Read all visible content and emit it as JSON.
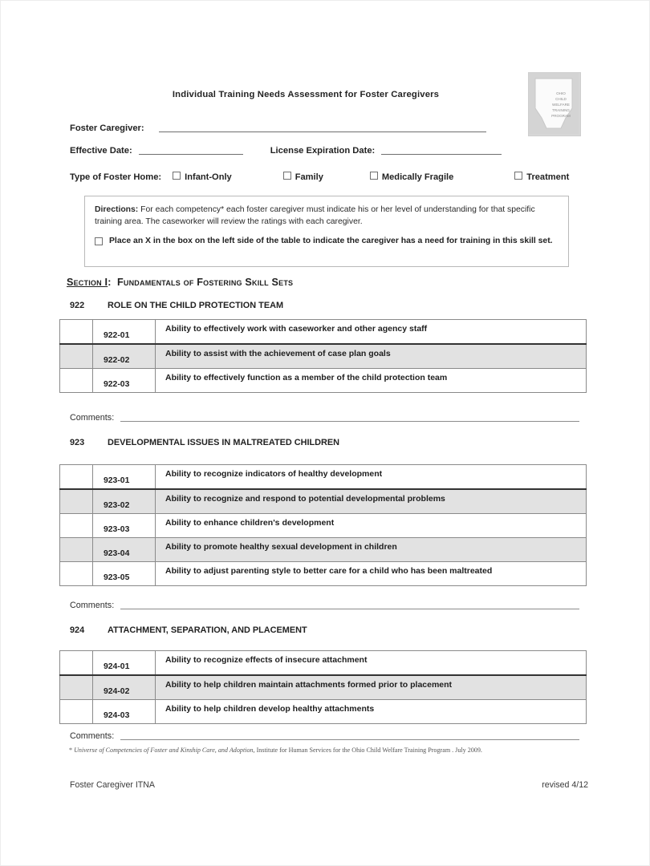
{
  "document": {
    "title": "Individual Training Needs Assessment for Foster Caregivers",
    "logo": {
      "name": "ohio-child-welfare-training-program-logo",
      "lines": [
        "OHIO",
        "CHILD",
        "WELFARE",
        "TRAINING",
        "PROGRAM"
      ]
    }
  },
  "fields": {
    "foster_caregiver_label": "Foster Caregiver:",
    "foster_caregiver_value": "",
    "effective_date_label": "Effective Date:",
    "effective_date_value": "",
    "license_expiration_label": "License Expiration Date:",
    "license_expiration_value": "",
    "type_of_home_label": "Type of Foster Home:",
    "type_options": [
      {
        "label": "Infant-Only",
        "checked": false
      },
      {
        "label": "Family",
        "checked": false
      },
      {
        "label": "Medically Fragile",
        "checked": false
      },
      {
        "label": "Treatment",
        "checked": false
      }
    ]
  },
  "directions": {
    "heading": "Directions:",
    "body": "For each competency* each foster caregiver must indicate his or her level of understanding for that specific training area.  The caseworker will review the ratings with each caregiver.",
    "note": "Place an X in the box on the left side of the table to indicate the caregiver has a need for training in this skill set.",
    "note_checked": false
  },
  "section": {
    "id": "Section I",
    "separator": ":",
    "title": "Fundamentals of Fostering Skill Sets"
  },
  "groups": [
    {
      "code": "922",
      "title": "ROLE ON THE CHILD PROTECTION TEAM",
      "rows": [
        {
          "code": "922-01",
          "desc": "Ability to effectively work with caseworker and other agency staff",
          "shaded": false,
          "checked": false
        },
        {
          "code": "922-02",
          "desc": "Ability to assist with the achievement of case plan goals",
          "shaded": true,
          "checked": false
        },
        {
          "code": "922-03",
          "desc": "Ability to effectively function as a member of the child protection team",
          "shaded": false,
          "checked": false
        }
      ],
      "comments_label": "Comments:",
      "comments_value": ""
    },
    {
      "code": "923",
      "title": "DEVELOPMENTAL ISSUES IN MALTREATED CHILDREN",
      "rows": [
        {
          "code": "923-01",
          "desc": "Ability to recognize indicators of healthy development",
          "shaded": false,
          "checked": false
        },
        {
          "code": "923-02",
          "desc": "Ability to recognize and respond to potential developmental problems",
          "shaded": true,
          "checked": false
        },
        {
          "code": "923-03",
          "desc": "Ability to enhance children's development",
          "shaded": false,
          "checked": false
        },
        {
          "code": "923-04",
          "desc": "Ability to promote healthy sexual development in children",
          "shaded": true,
          "checked": false
        },
        {
          "code": "923-05",
          "desc": "Ability to adjust parenting style to better care for a child who has been maltreated",
          "shaded": false,
          "checked": false
        }
      ],
      "comments_label": "Comments:",
      "comments_value": ""
    },
    {
      "code": "924",
      "title": "ATTACHMENT, SEPARATION, AND PLACEMENT",
      "rows": [
        {
          "code": "924-01",
          "desc": "Ability to recognize effects of insecure attachment",
          "shaded": false,
          "checked": false
        },
        {
          "code": "924-02",
          "desc": "Ability to help children maintain attachments formed prior to placement",
          "shaded": true,
          "checked": false
        },
        {
          "code": "924-03",
          "desc": "Ability to help children develop healthy attachments",
          "shaded": false,
          "checked": false
        }
      ],
      "comments_label": "Comments:",
      "comments_value": ""
    }
  ],
  "footnote": {
    "marker": "*",
    "italic_part": "Universe of Competencies of Foster and Kinship Care, and Adoption",
    "rest": ", Institute for Human Services for the Ohio Child Welfare Training Program . July 2009."
  },
  "footer": {
    "left": "Foster Caregiver ITNA",
    "right": "revised 4/12"
  },
  "colors": {
    "shaded_row": "#e2e2e2",
    "rule": "#6e6e6e",
    "border": "#8a8a8a",
    "text": "#1e1e1e"
  }
}
